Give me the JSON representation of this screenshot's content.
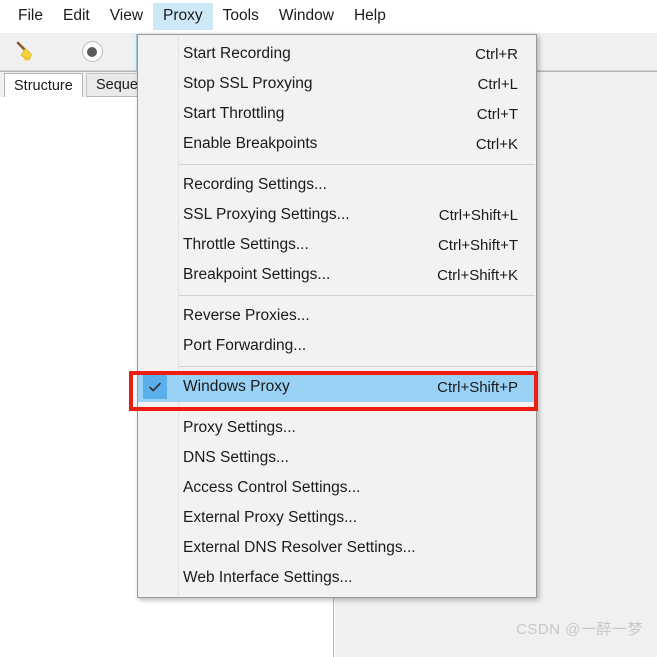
{
  "menubar": {
    "items": [
      {
        "label": "File",
        "open": false
      },
      {
        "label": "Edit",
        "open": false
      },
      {
        "label": "View",
        "open": false
      },
      {
        "label": "Proxy",
        "open": true
      },
      {
        "label": "Tools",
        "open": false
      },
      {
        "label": "Window",
        "open": false
      },
      {
        "label": "Help",
        "open": false
      }
    ]
  },
  "toolbar": {
    "buttons": [
      {
        "icon": "broom-icon",
        "selected": false
      },
      {
        "icon": "record-icon",
        "selected": false
      },
      {
        "icon": "lock-icon",
        "selected": true
      }
    ]
  },
  "tabs": [
    {
      "label": "Structure",
      "active": true
    },
    {
      "label": "Seque",
      "active": false
    }
  ],
  "proxy_menu": {
    "title": "Proxy",
    "groups": [
      {
        "items": [
          {
            "label": "Start Recording",
            "accel": "Ctrl+R",
            "checked": false
          },
          {
            "label": "Stop SSL Proxying",
            "accel": "Ctrl+L",
            "checked": false
          },
          {
            "label": "Start Throttling",
            "accel": "Ctrl+T",
            "checked": false
          },
          {
            "label": "Enable Breakpoints",
            "accel": "Ctrl+K",
            "checked": false
          }
        ]
      },
      {
        "items": [
          {
            "label": "Recording Settings...",
            "accel": "",
            "checked": false
          },
          {
            "label": "SSL Proxying Settings...",
            "accel": "Ctrl+Shift+L",
            "checked": false
          },
          {
            "label": "Throttle Settings...",
            "accel": "Ctrl+Shift+T",
            "checked": false
          },
          {
            "label": "Breakpoint Settings...",
            "accel": "Ctrl+Shift+K",
            "checked": false
          }
        ]
      },
      {
        "items": [
          {
            "label": "Reverse Proxies...",
            "accel": "",
            "checked": false
          },
          {
            "label": "Port Forwarding...",
            "accel": "",
            "checked": false
          }
        ]
      },
      {
        "items": [
          {
            "label": "Windows Proxy",
            "accel": "Ctrl+Shift+P",
            "checked": true
          }
        ]
      },
      {
        "items": [
          {
            "label": "Proxy Settings...",
            "accel": "",
            "checked": false
          },
          {
            "label": "DNS Settings...",
            "accel": "",
            "checked": false
          },
          {
            "label": "Access Control Settings...",
            "accel": "",
            "checked": false
          },
          {
            "label": "External Proxy Settings...",
            "accel": "",
            "checked": false
          },
          {
            "label": "External DNS Resolver Settings...",
            "accel": "",
            "checked": false
          },
          {
            "label": "Web Interface Settings...",
            "accel": "",
            "checked": false
          }
        ]
      }
    ]
  },
  "annotation": {
    "target_label": "Windows Proxy",
    "color": "#ee1c11"
  },
  "watermark": {
    "text": "CSDN @一醉一梦"
  },
  "colors": {
    "menu_background": "#f2f2f2",
    "menu_highlight": "#9ad2f5",
    "check_box": "#5bb0ec",
    "menubar_open": "#cde8f7",
    "toolbar_background": "#f0f0f0",
    "annotation_red": "#ee1c11"
  }
}
